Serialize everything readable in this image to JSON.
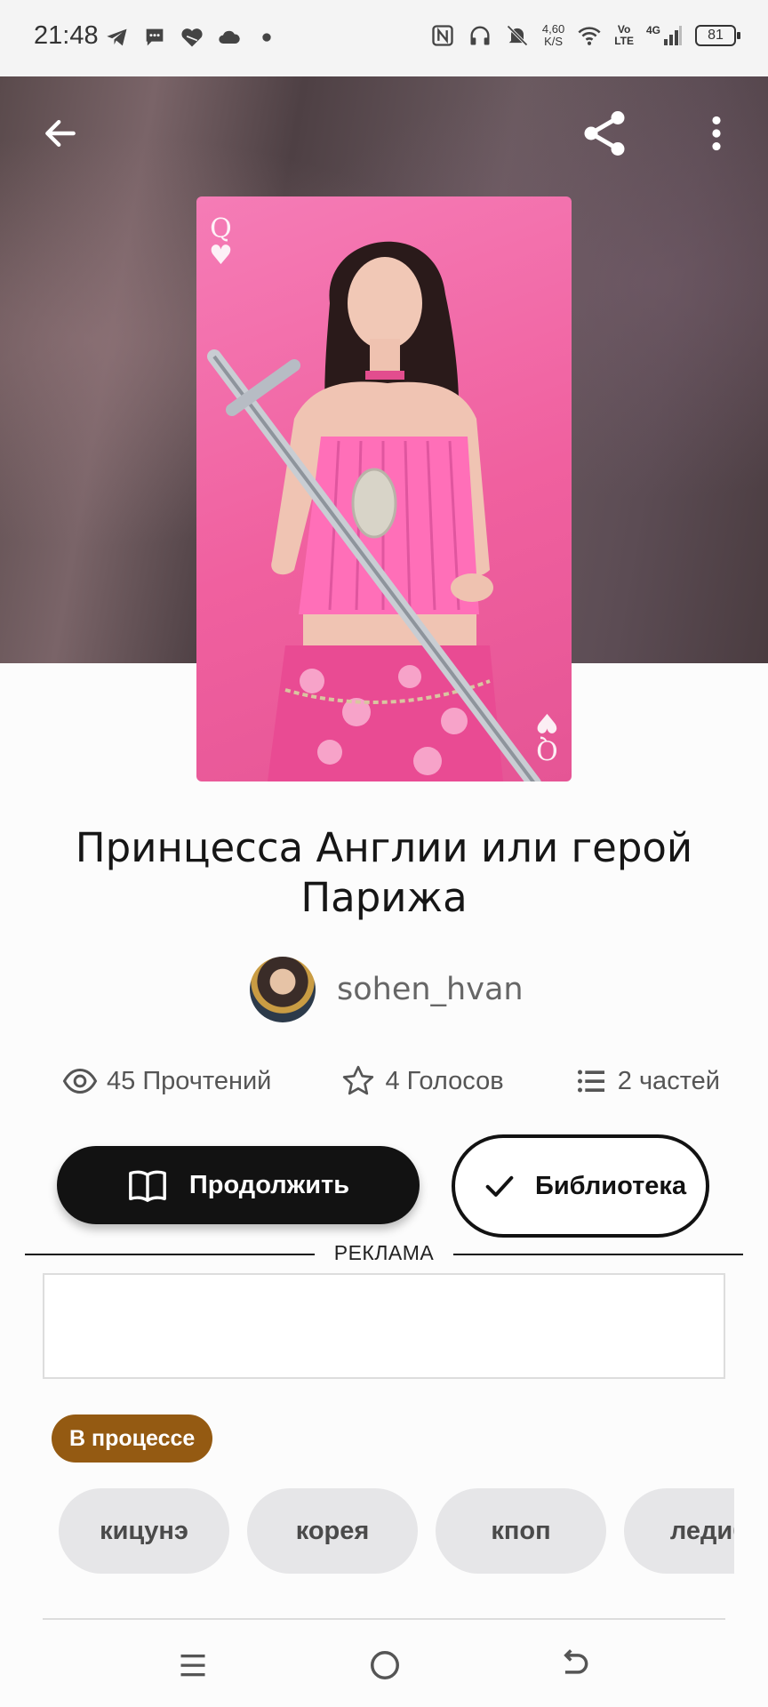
{
  "status_bar": {
    "time": "21:48",
    "net_speed_value": "4,60",
    "net_speed_unit": "K/S",
    "volte_top": "Vo",
    "volte_bottom": "LTE",
    "signal_label": "4G",
    "battery": "81",
    "left_icons": [
      "telegram-icon",
      "chat-icon",
      "heart-app-icon",
      "cloud-icon",
      "dot-icon"
    ],
    "right_icons": [
      "nfc-icon",
      "headphones-icon",
      "mute-icon",
      "wifi-icon",
      "signal-icon",
      "battery-icon"
    ]
  },
  "header": {
    "icons": [
      "back-arrow-icon",
      "share-icon",
      "more-vertical-icon"
    ]
  },
  "cover": {
    "card_rank": "Q",
    "card_suit": "♥"
  },
  "story": {
    "title": "Принцесса Англии или герой Парижа",
    "author": "sohen_hvan"
  },
  "stats": {
    "reads": "45 Прочтений",
    "votes": "4 Голосов",
    "parts": "2 частей"
  },
  "actions": {
    "continue_label": "Продолжить",
    "library_label": "Библиотека"
  },
  "ad": {
    "label": "РЕКЛАМА"
  },
  "status_badge": "В процессе",
  "tags": [
    "кицунэ",
    "корея",
    "кпоп",
    "ледиб"
  ],
  "colors": {
    "status_badge_bg": "#945a12",
    "button_dark": "#121212",
    "tag_bg": "#e6e6e8",
    "cover_pink": "#f0609f"
  },
  "nav_bar": {
    "icons": [
      "recent-apps-icon",
      "home-icon",
      "back-nav-icon"
    ]
  }
}
